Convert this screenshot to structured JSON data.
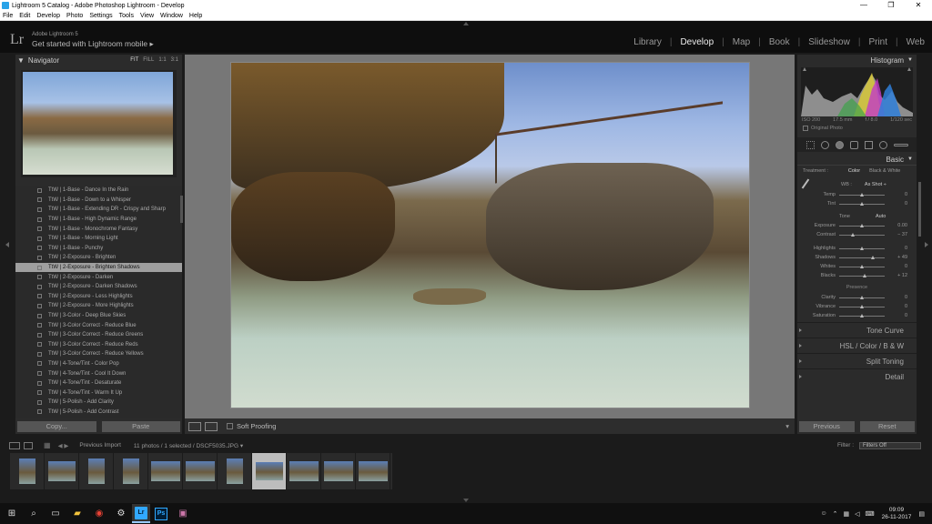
{
  "window": {
    "title": "Lightroom 5 Catalog - Adobe Photoshop Lightroom - Develop"
  },
  "menu": [
    "File",
    "Edit",
    "Develop",
    "Photo",
    "Settings",
    "Tools",
    "View",
    "Window",
    "Help"
  ],
  "identity": {
    "logo": "Lr",
    "product": "Adobe Lightroom 5",
    "promo": "Get started with Lightroom mobile ▸"
  },
  "modules": [
    "Library",
    "Develop",
    "Map",
    "Book",
    "Slideshow",
    "Print",
    "Web"
  ],
  "active_module": "Develop",
  "navigator": {
    "title": "Navigator",
    "zoom": [
      "FIT",
      "FILL",
      "1:1",
      "3:1"
    ]
  },
  "presets": [
    "TtW | 1-Base - Dance In the Rain",
    "TtW | 1-Base - Down to a Whisper",
    "TtW | 1-Base - Extending DR - Crispy and Sharp",
    "TtW | 1-Base - High Dynamic Range",
    "TtW | 1-Base - Monochrome Fantasy",
    "TtW | 1-Base - Morning Light",
    "TtW | 1-Base - Punchy",
    "TtW | 2-Exposure - Brighten",
    "TtW | 2-Exposure - Brighten Shadows",
    "TtW | 2-Exposure - Darken",
    "TtW | 2-Exposure - Darken Shadows",
    "TtW | 2-Exposure - Less Highlights",
    "TtW | 2-Exposure - More Highlights",
    "TtW | 3-Color - Deep Blue Skies",
    "TtW | 3-Color Correct - Reduce Blue",
    "TtW | 3-Color Correct - Reduce Greens",
    "TtW | 3-Color Correct - Reduce Reds",
    "TtW | 3-Color Correct - Reduce Yellows",
    "TtW | 4-Tone/Tint - Color Pop",
    "TtW | 4-Tone/Tint - Cool It Down",
    "TtW | 4-Tone/Tint - Desaturate",
    "TtW | 4-Tone/Tint - Warm It Up",
    "TtW | 5-Polish - Add Clarity",
    "TtW | 5-Polish - Add Contrast"
  ],
  "selected_preset_index": 8,
  "left_buttons": {
    "copy": "Copy...",
    "paste": "Paste"
  },
  "toolbar": {
    "soft_proofing": "Soft Proofing"
  },
  "histogram": {
    "title": "Histogram",
    "iso": "ISO 200",
    "focal": "17.5 mm",
    "aperture": "f / 8.0",
    "shutter": "1/120 sec",
    "original_photo": "Original Photo"
  },
  "basic": {
    "title": "Basic",
    "treatment_label": "Treatment :",
    "color": "Color",
    "bw": "Black & White",
    "wb_label": "WB :",
    "wb_value": "As Shot ÷",
    "tone_label": "Tone",
    "auto": "Auto",
    "presence_label": "Presence",
    "sliders_wb": [
      {
        "label": "Temp",
        "value": "0"
      },
      {
        "label": "Tint",
        "value": "0"
      }
    ],
    "sliders_tone": [
      {
        "label": "Exposure",
        "value": "0.00"
      },
      {
        "label": "Contrast",
        "value": "− 37"
      }
    ],
    "sliders_tone2": [
      {
        "label": "Highlights",
        "value": "0"
      },
      {
        "label": "Shadows",
        "value": "+ 49"
      },
      {
        "label": "Whites",
        "value": "0"
      },
      {
        "label": "Blacks",
        "value": "+ 12"
      }
    ],
    "sliders_presence": [
      {
        "label": "Clarity",
        "value": "0"
      },
      {
        "label": "Vibrance",
        "value": "0"
      },
      {
        "label": "Saturation",
        "value": "0"
      }
    ]
  },
  "sections": {
    "tone_curve": "Tone Curve",
    "hsl": "HSL  /  Color  /  B & W",
    "split": "Split Toning",
    "detail": "Detail"
  },
  "right_buttons": {
    "previous": "Previous",
    "reset": "Reset"
  },
  "filmbar": {
    "source": "Previous Import",
    "count": "11 photos / 1 selected / DSCF5035.JPG ▾",
    "filter_label": "Filter :",
    "filter_value": "Filters Off"
  },
  "taskbar": {
    "time": "09:09",
    "date": "26-11-2017"
  }
}
